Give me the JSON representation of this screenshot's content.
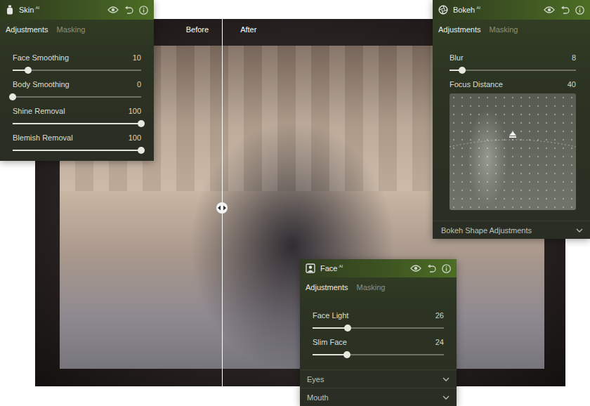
{
  "comparison": {
    "before": "Before",
    "after": "After",
    "split": 0.335
  },
  "panels": [
    {
      "kind": "skin",
      "title": "Skin",
      "badge": "AI",
      "tabs": [
        {
          "label": "Adjustments",
          "selected": true
        },
        {
          "label": "Masking",
          "selected": false
        }
      ],
      "controls": [
        {
          "kind": "slider",
          "label": "Face Smoothing",
          "value": "10",
          "level": 0.12
        },
        {
          "kind": "slider",
          "label": "Body Smoothing",
          "value": "0",
          "level": 0
        },
        {
          "kind": "slider",
          "label": "Shine Removal",
          "value": "100",
          "level": 1
        },
        {
          "kind": "slider",
          "label": "Blemish Removal",
          "value": "100",
          "level": 1
        }
      ],
      "sections": []
    },
    {
      "kind": "bokeh",
      "title": "Bokeh",
      "badge": "AI",
      "tabs": [
        {
          "label": "Adjustments",
          "selected": true
        },
        {
          "label": "Masking",
          "selected": false
        }
      ],
      "controls": [
        {
          "kind": "slider",
          "label": "Blur",
          "value": "8",
          "level": 0.1
        },
        {
          "kind": "depth-map",
          "label": "Focus Distance",
          "value": "40",
          "level": 0.4
        }
      ],
      "sections": [
        {
          "label": "Bokeh Shape Adjustments",
          "expanded": false
        }
      ]
    },
    {
      "kind": "face",
      "title": "Face",
      "badge": "AI",
      "tabs": [
        {
          "label": "Adjustments",
          "selected": true
        },
        {
          "label": "Masking",
          "selected": false
        }
      ],
      "controls": [
        {
          "kind": "slider",
          "label": "Face Light",
          "value": "26",
          "level": 0.27
        },
        {
          "kind": "slider",
          "label": "Slim Face",
          "value": "24",
          "level": 0.26
        }
      ],
      "sections": [
        {
          "label": "Eyes",
          "expanded": false
        },
        {
          "label": "Mouth",
          "expanded": false
        }
      ]
    }
  ]
}
